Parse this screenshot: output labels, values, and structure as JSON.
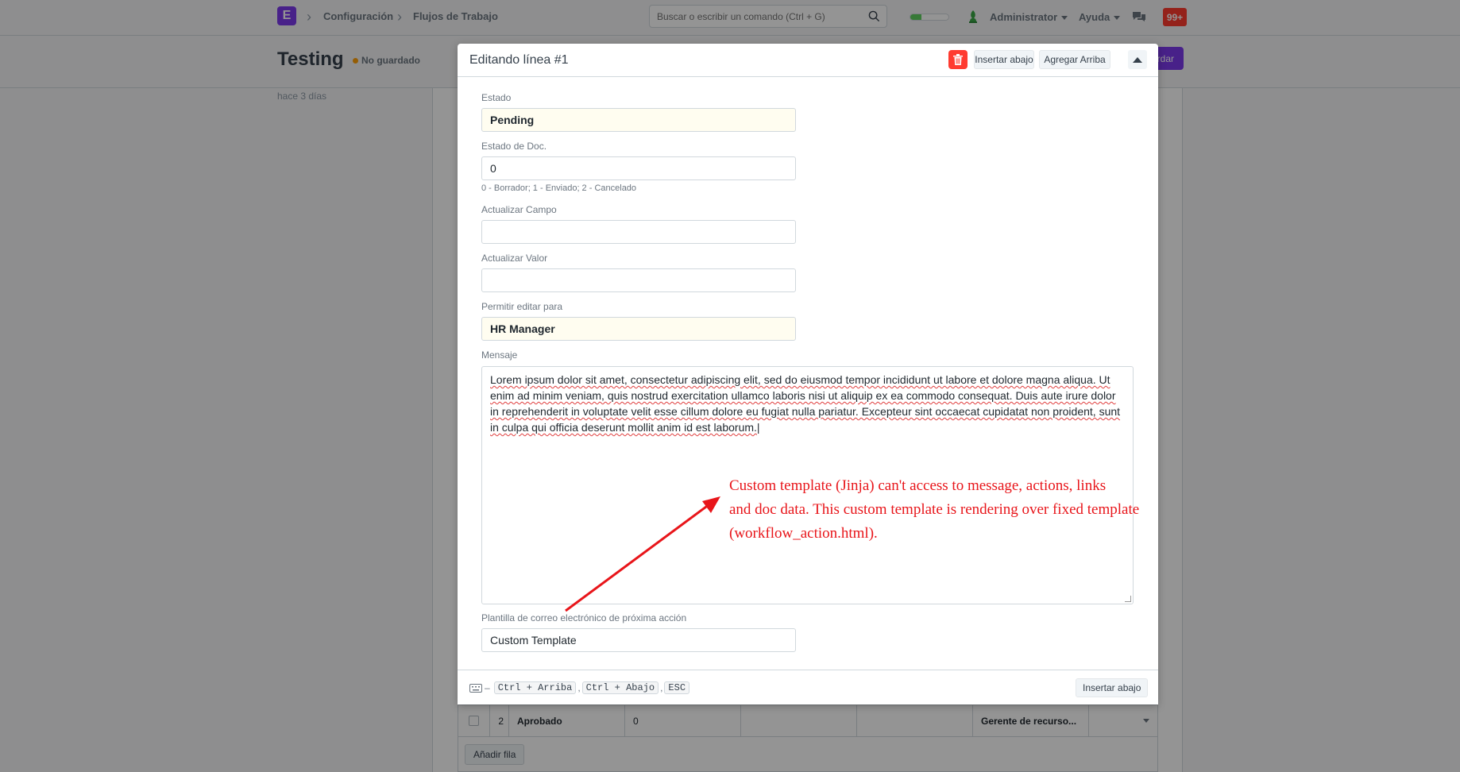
{
  "navbar": {
    "logo_letter": "E",
    "breadcrumbs": [
      "Configuración",
      "Flujos de Trabajo"
    ],
    "search_placeholder": "Buscar o escribir un comando (Ctrl + G)",
    "progress_fraction": 0.3,
    "user_menu": "Administrator",
    "help_menu": "Ayuda",
    "notification_count": "99+"
  },
  "page": {
    "title": "Testing",
    "status": "No guardado",
    "save_label": "Guardar",
    "timeline_text": "hace 3 días"
  },
  "modal": {
    "title": "Editando línea #1",
    "insert_below_label": "Insertar abajo",
    "insert_above_label": "Agregar Arriba",
    "fields": {
      "state": {
        "label": "Estado",
        "value": "Pending"
      },
      "doc_status": {
        "label": "Estado de Doc.",
        "value": "0",
        "description": "0 - Borrador; 1 - Enviado; 2 - Cancelado"
      },
      "update_field": {
        "label": "Actualizar Campo",
        "value": ""
      },
      "update_value": {
        "label": "Actualizar Valor",
        "value": ""
      },
      "allow_edit": {
        "label": "Permitir editar para",
        "value": "HR Manager"
      },
      "message": {
        "label": "Mensaje",
        "value": "Lorem ipsum dolor sit amet, consectetur adipiscing elit, sed do eiusmod tempor incididunt ut labore et dolore magna aliqua. Ut enim ad minim veniam, quis nostrud exercitation ullamco laboris nisi ut aliquip ex ea commodo consequat. Duis aute irure dolor in reprehenderit in voluptate velit esse cillum dolore eu fugiat nulla pariatur. Excepteur sint occaecat cupidatat non proident, sunt in culpa qui officia deserunt mollit anim id est laborum."
      },
      "next_action_template": {
        "label": "Plantilla de correo electrónico de próxima acción",
        "value": "Custom Template"
      }
    },
    "footer": {
      "shortcuts": [
        "Ctrl + Arriba",
        "Ctrl + Abajo",
        "ESC"
      ],
      "insert_below_label": "Insertar abajo"
    }
  },
  "annotation": {
    "lines": [
      "Custom template (Jinja) can't access to message, actions, links",
      "and doc data. This custom template is rendering over fixed template",
      "(workflow_action.html)."
    ],
    "color": "#e8151a"
  },
  "grid": {
    "row": {
      "index": "2",
      "state": "Aprobado",
      "doc_status": "0",
      "allow_edit": "Gerente de recurso..."
    },
    "add_row_label": "Añadir fila"
  },
  "colors": {
    "brand": "#7c3aed",
    "danger": "#ff3b30",
    "input_highlight": "#fffdf0"
  }
}
